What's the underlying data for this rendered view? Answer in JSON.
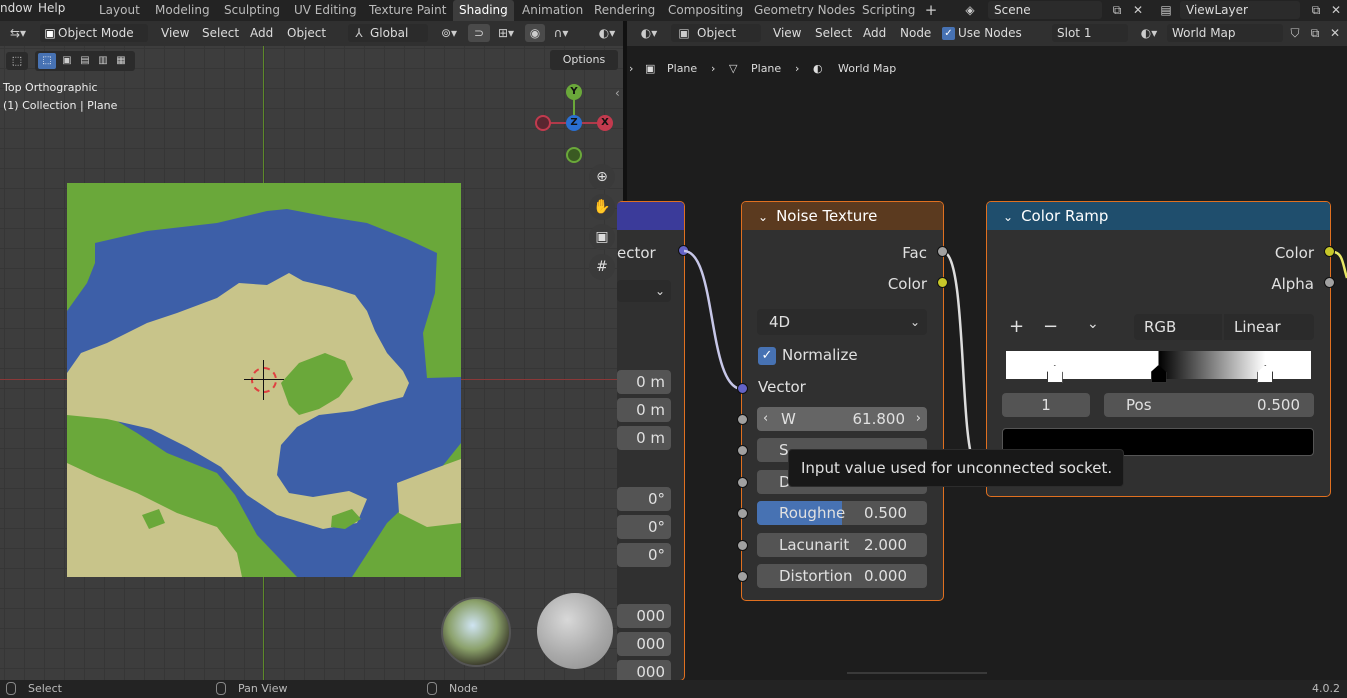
{
  "topbar": {
    "menus": [
      "ndow",
      "Help"
    ],
    "workspaces": [
      "Layout",
      "Modeling",
      "Sculpting",
      "UV Editing",
      "Texture Paint",
      "Shading",
      "Animation",
      "Rendering",
      "Compositing",
      "Geometry Nodes",
      "Scripting"
    ],
    "active_workspace": "Shading",
    "scene": "Scene",
    "view_layer": "ViewLayer"
  },
  "viewport_header": {
    "mode": "Object Mode",
    "menus": [
      "View",
      "Select",
      "Add",
      "Object"
    ],
    "transform": "Global",
    "options": "Options"
  },
  "viewport": {
    "view_name": "Top Orthographic",
    "collection": "(1) Collection | Plane",
    "gizmo": {
      "y": "Y",
      "x": "X"
    }
  },
  "node_header": {
    "type": "Object",
    "menus": [
      "View",
      "Select",
      "Add",
      "Node"
    ],
    "use_nodes_label": "Use Nodes",
    "use_nodes_checked": true,
    "slot": "Slot 1",
    "material": "World Map"
  },
  "breadcrumb": [
    "Plane",
    "Plane",
    "World Map"
  ],
  "left_node": {
    "socket_label": "ector",
    "fields": [
      "0 m",
      "0 m",
      "0 m",
      "0°",
      "0°",
      "0°",
      "000",
      "000",
      "000"
    ]
  },
  "noise_node": {
    "title": "Noise Texture",
    "outputs": [
      "Fac",
      "Color"
    ],
    "dimensions": "4D",
    "normalize_label": "Normalize",
    "normalize_checked": true,
    "vector_label": "Vector",
    "w_label": "W",
    "w_value": "61.800",
    "scale_label": "S",
    "scale_value_partial": "",
    "detail_label": "D",
    "roughness_label": "Roughne",
    "roughness_value": "0.500",
    "roughness_fill": 0.5,
    "lacunarity_label": "Lacunarit",
    "lacunarity_value": "2.000",
    "distortion_label": "Distortion",
    "distortion_value": "0.000"
  },
  "ramp_node": {
    "title": "Color Ramp",
    "outputs": [
      "Color",
      "Alpha"
    ],
    "color_mode": "RGB",
    "interpolation": "Linear",
    "index": "1",
    "pos_label": "Pos",
    "pos_value": "0.500",
    "stops": [
      0.16,
      0.5,
      0.85
    ]
  },
  "tooltip": "Input value used for unconnected socket.",
  "statusbar": {
    "select": "Select",
    "pan": "Pan View",
    "node": "Node",
    "version": "4.0.2"
  },
  "colors": {
    "node_border": "#e07020",
    "noise_header": "#5b3a1f",
    "ramp_header": "#1f4e6d",
    "socket_vector": "#6363c7",
    "socket_float": "#a1a1a1",
    "socket_color": "#c7c729",
    "map_water": "#3d5fa8",
    "map_land": "#c8c48a",
    "map_grass": "#6aa83a"
  }
}
